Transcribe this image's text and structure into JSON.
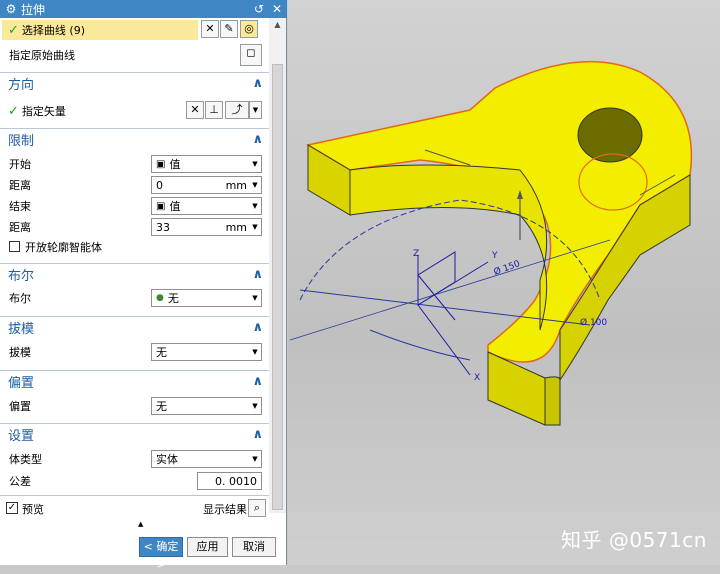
{
  "dialog": {
    "title": "拉伸",
    "gear_icon": "gear-icon",
    "reset_icon": "reset-icon",
    "close_icon": "close-icon",
    "section_line": {
      "select_curve": "选择曲线 (9)",
      "specify_original_curve": "指定原始曲线"
    },
    "section_direction": {
      "title": "方向",
      "specify_vector": "指定矢量"
    },
    "section_limits": {
      "title": "限制",
      "start_label": "开始",
      "start_value": "值",
      "distance1_label": "距离",
      "distance1_value": "0",
      "distance1_unit": "mm",
      "end_label": "结束",
      "end_value": "值",
      "distance2_label": "距离",
      "distance2_value": "33",
      "distance2_unit": "mm",
      "open_profile": "开放轮廓智能体"
    },
    "section_boolean": {
      "title": "布尔",
      "label": "布尔",
      "value": "无"
    },
    "section_draft": {
      "title": "拔模",
      "label": "拔模",
      "value": "无"
    },
    "section_offset": {
      "title": "偏置",
      "label": "偏置",
      "value": "无"
    },
    "section_settings": {
      "title": "设置",
      "body_type_label": "体类型",
      "body_type_value": "实体",
      "tolerance_label": "公差",
      "tolerance_value": "0. 0010"
    },
    "preview_label": "预览",
    "show_result": "显示结果",
    "ok_button": "< 确定 >",
    "apply_button": "应用",
    "cancel_button": "取消"
  },
  "viewport": {
    "dim_150": "Ø 150",
    "dim_100": "Ø 100",
    "axis_x": "X",
    "axis_y": "Y",
    "axis_z": "Z",
    "watermark": "知乎 @0571cn"
  },
  "colors": {
    "titlebar": "#3e86c4",
    "section_title": "#1e5fa3",
    "part_fill": "#f3ee00",
    "edge": "#e06a1a"
  }
}
